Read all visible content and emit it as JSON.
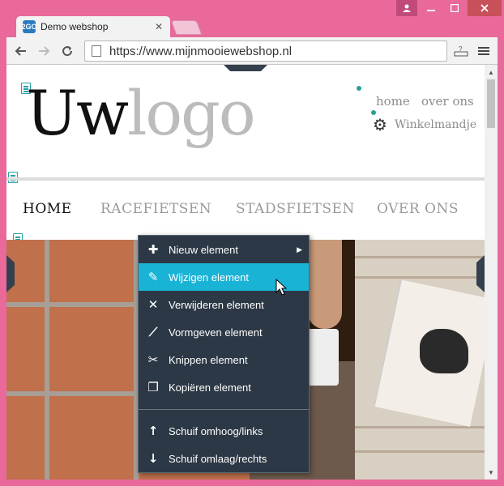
{
  "browser": {
    "tab_title": "Demo webshop",
    "tab_favicon_text": "2GO",
    "url": "https://www.mijnmooiewebshop.nl"
  },
  "site": {
    "logo_dark": "Uw",
    "logo_light": "logo",
    "top_links": [
      "home",
      "over ons"
    ],
    "cart_label": "Winkelmandje",
    "nav": [
      {
        "label": "HOME",
        "active": true
      },
      {
        "label": "RACEFIETSEN",
        "active": false
      },
      {
        "label": "STADSFIETSEN",
        "active": false
      },
      {
        "label": "OVER ONS",
        "active": false
      }
    ]
  },
  "context_menu": {
    "items": [
      {
        "label": "Nieuw element",
        "icon": "plus-icon",
        "has_submenu": true
      },
      {
        "label": "Wijzigen element",
        "icon": "pencil-icon",
        "highlighted": true
      },
      {
        "label": "Verwijderen element",
        "icon": "x-icon"
      },
      {
        "label": "Vormgeven element",
        "icon": "brush-icon"
      },
      {
        "label": "Knippen element",
        "icon": "scissors-icon"
      },
      {
        "label": "Kopiëren element",
        "icon": "copy-icon"
      },
      {
        "label": "Schuif omhoog/links",
        "icon": "arrow-up-icon"
      },
      {
        "label": "Schuif omlaag/rechts",
        "icon": "arrow-down-icon"
      }
    ]
  },
  "colors": {
    "window_frame": "#e8699a",
    "menu_bg": "#2c3845",
    "menu_highlight": "#19b3d6",
    "teal_accent": "#2aa093"
  }
}
